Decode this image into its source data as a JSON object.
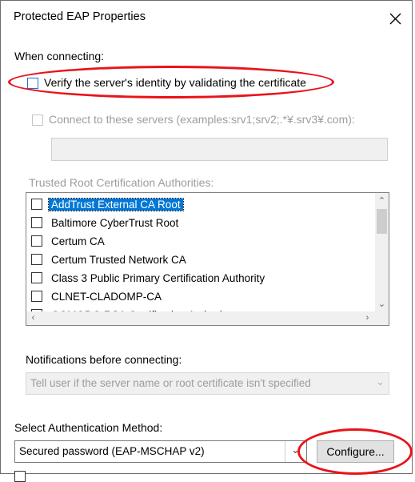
{
  "window": {
    "title": "Protected EAP Properties",
    "close_icon": "close-icon"
  },
  "when_connecting": {
    "label": "When connecting:",
    "verify_server": {
      "label": "Verify the server's identity by validating the certificate",
      "checked": false
    },
    "connect_servers": {
      "label": "Connect to these servers (examples:srv1;srv2;.*¥.srv3¥.com):",
      "checked": false,
      "enabled": false
    },
    "servers_input": {
      "value": "",
      "enabled": false
    }
  },
  "trusted_roots": {
    "label": "Trusted Root Certification Authorities:",
    "items": [
      {
        "label": "AddTrust External CA Root",
        "checked": false,
        "selected": true
      },
      {
        "label": "Baltimore CyberTrust Root",
        "checked": false,
        "selected": false
      },
      {
        "label": "Certum CA",
        "checked": false,
        "selected": false
      },
      {
        "label": "Certum Trusted Network CA",
        "checked": false,
        "selected": false
      },
      {
        "label": "Class 3 Public Primary Certification Authority",
        "checked": false,
        "selected": false
      },
      {
        "label": "CLNET-CLADOMP-CA",
        "checked": false,
        "selected": false
      },
      {
        "label": "COMODO RSA Certification Authority",
        "checked": false,
        "selected": false
      }
    ]
  },
  "notifications": {
    "label": "Notifications before connecting:",
    "selected": "Tell user if the server name or root certificate isn't specified"
  },
  "auth_method": {
    "label": "Select Authentication Method:",
    "selected": "Secured password (EAP-MSCHAP v2)",
    "configure_label": "Configure..."
  },
  "colors": {
    "annotation_red": "#e8141a",
    "selection_blue": "#0078d7"
  }
}
